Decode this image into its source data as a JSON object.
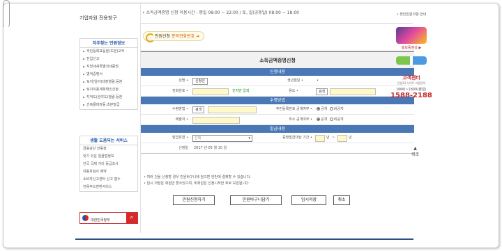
{
  "left_nav": {
    "title": "기업자원 전용창구",
    "box1_header": "자주찾는 민원정보",
    "box1_items": [
      "주민등록표등본(초본)교부",
      "전입신고",
      "지방세세목별과세증명",
      "병적증명서",
      "토지(임야)대장열람.등본",
      "토지이용계획확인신청",
      "지적도(임야도)열람.등본",
      "건축물대장등.초본발급"
    ],
    "box2_header": "생활 도움되는 서비스",
    "box2_items": [
      "금융감단 안동장",
      "잊기 쉬운 일꿈법정보",
      "안국 국제 거리 등급조사",
      "자동차검사 예약",
      "소비자신고센터 신고 접수",
      "전용주소변환서비스"
    ],
    "search_label": "대한민국정부",
    "search_icon": "search-icon"
  },
  "notice": "• 소득금액증명 신청 이용시간 : 평일 08:00 ~ 22:00 / 토, 일(공휴일) 08:00 ~ 18:00",
  "civil_button": {
    "text1": "민원신청",
    "text2": " 문의전화번호 ➔"
  },
  "form": {
    "title": "소득금액증명신청",
    "sec1": "신청내용",
    "name_label": "성명 •",
    "verify_btn": "신청인",
    "birth_label": "생년월일 •",
    "birth_value": "•",
    "phone_label": "전화번호 •",
    "phone_hint": "숫자만 입력",
    "purpose_label": "용도 •",
    "search_btn": "검색",
    "sec2": "수령방법",
    "receive_label": "수령방법 •",
    "rrn_public_label": "주민등록번호 공개여부 •",
    "radio_public": "공개",
    "radio_private": "비공개",
    "receiver_label": "제출처 •",
    "addr_public_label": "주소 공개여부 •",
    "sec3": "발급내용",
    "issue_type_label": "발급유형 •",
    "issue_type_value": "선택",
    "period_label": "증명발급대상 기간 •",
    "period_year1": "년",
    "period_tilde": "~",
    "period_year2": "년",
    "date_label": "신청일",
    "date_value": "2017 년 05 월 10 일"
  },
  "notes": [
    "• 여러 건을 신청할 경우 민원바구니에 담으면 한번에 결제할 수 있습니다.",
    "• 임시 저장은 회원만 할수있으며, 비회원은 신청시작한 후로 보관됩니다."
  ],
  "actions": [
    "민원신청하기",
    "민원바구니담기",
    "임시저장",
    "취소"
  ],
  "right": {
    "top_text": "• 생인민원사항 안내",
    "video_label": "홍보동영상 ▶",
    "help_title": "고객센터",
    "help_sub": "민원24 사이트 이용문의",
    "help_hours": "0900~1800(평일)",
    "help_phone": "1588-2188",
    "updown": "위로"
  }
}
